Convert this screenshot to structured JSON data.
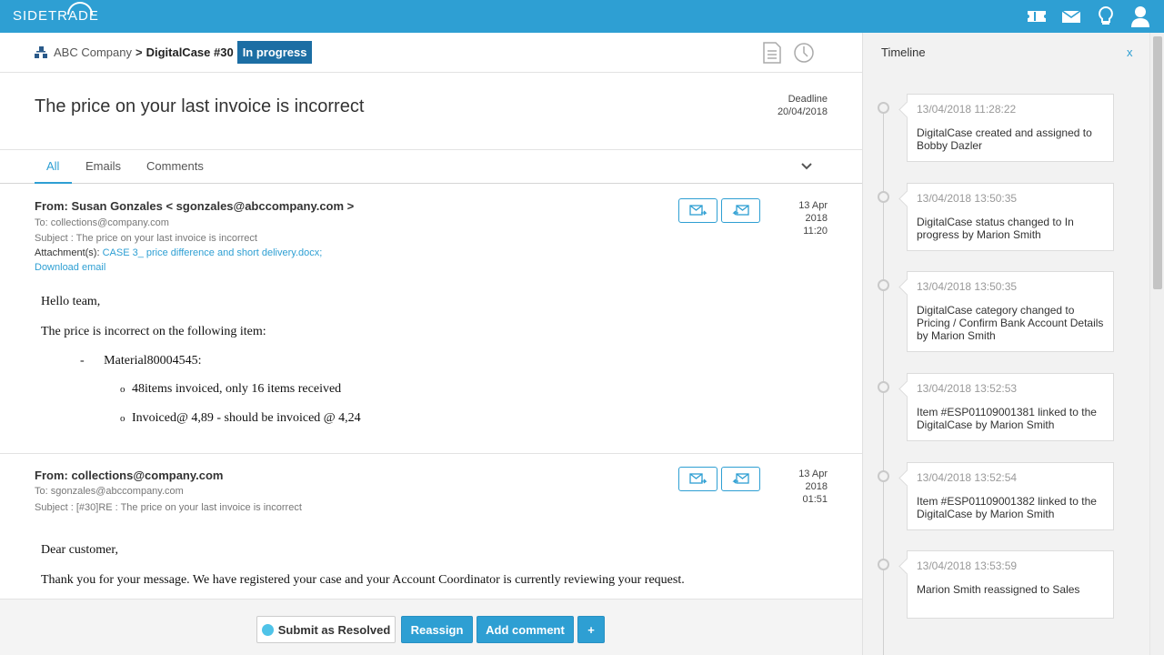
{
  "app": {
    "logo": "SIDETRADE",
    "colors": {
      "brand": "#2e9fd3",
      "badge": "#1c6ea4",
      "resolve_dot": "#4fc3e8"
    },
    "top_icons": [
      "ticket-icon",
      "mail-icon",
      "lightbulb-icon",
      "user-icon"
    ]
  },
  "breadcrumb": {
    "company": "ABC Company",
    "separator": ">",
    "case": "DigitalCase #30",
    "status": "In progress"
  },
  "case": {
    "title": "The price on your last invoice is incorrect",
    "deadline_label": "Deadline",
    "deadline_value": "20/04/2018"
  },
  "tabs": [
    {
      "label": "All",
      "active": true
    },
    {
      "label": "Emails",
      "active": false
    },
    {
      "label": "Comments",
      "active": false
    }
  ],
  "emails": [
    {
      "from": "From: Susan Gonzales < sgonzales@abccompany.com >",
      "to": "To: collections@company.com",
      "subject": "Subject : The price on your last invoice is incorrect",
      "attachment_label": "Attachment(s):",
      "attachment_file": "CASE 3_ price difference and short delivery.docx;",
      "download": "Download email",
      "date_day": "13 Apr",
      "date_year": "2018",
      "date_time": "11:20",
      "body": {
        "greeting": "Hello team,",
        "line1": "The price is incorrect on the following item:",
        "dash": "-",
        "item": "Material80004545:",
        "bullet": "o",
        "sub1": "48items invoiced, only 16 items received",
        "sub2": "Invoiced@ 4,89 -  should be invoiced @ 4,24"
      }
    },
    {
      "from": "From: collections@company.com",
      "to": "To: sgonzales@abccompany.com",
      "subject": "Subject : [#30]RE : The price on your last invoice is incorrect",
      "date_day": "13 Apr",
      "date_year": "2018",
      "date_time": "01:51",
      "body": {
        "greeting": "Dear customer,",
        "line1": "Thank you for your message. We have registered your case and your Account Coordinator is currently reviewing your request."
      }
    }
  ],
  "footer": {
    "resolve": "Submit as Resolved",
    "reassign": "Reassign",
    "add_comment": "Add comment",
    "plus": "+"
  },
  "timeline": {
    "title": "Timeline",
    "close": "x",
    "events": [
      {
        "time": "13/04/2018 11:28:22",
        "desc": "DigitalCase created and assigned to Bobby Dazler"
      },
      {
        "time": "13/04/2018 13:50:35",
        "desc": "DigitalCase status changed to In progress by Marion Smith"
      },
      {
        "time": "13/04/2018 13:50:35",
        "desc": "DigitalCase category changed to Pricing / Confirm Bank Account Details by Marion Smith"
      },
      {
        "time": "13/04/2018 13:52:53",
        "desc": "Item #ESP01109001381 linked to the DigitalCase by Marion Smith"
      },
      {
        "time": "13/04/2018 13:52:54",
        "desc": "Item #ESP01109001382 linked to the DigitalCase by Marion Smith"
      },
      {
        "time": "13/04/2018 13:53:59",
        "desc": "Marion Smith reassigned to Sales"
      }
    ]
  }
}
